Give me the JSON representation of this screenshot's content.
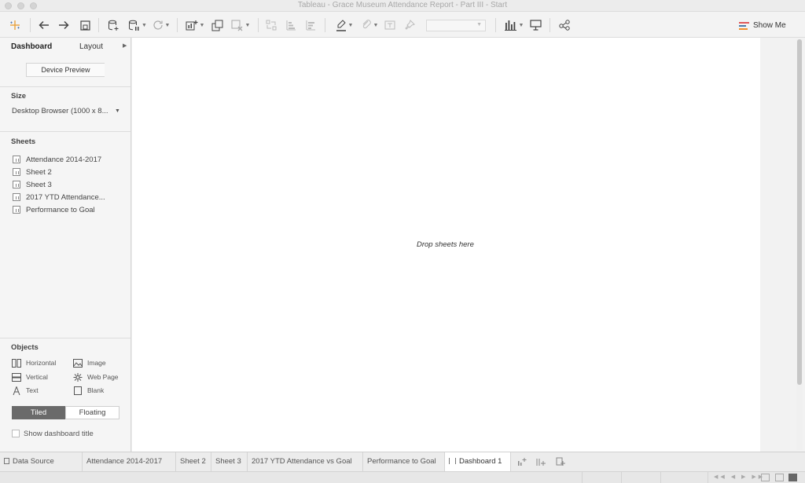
{
  "window": {
    "title": "Tableau - Grace Museum Attendance Report - Part III - Start"
  },
  "toolbar": {
    "show_me_label": "Show Me"
  },
  "left_pane": {
    "tabs": [
      "Dashboard",
      "Layout"
    ],
    "device_preview_label": "Device Preview",
    "size": {
      "title": "Size",
      "value": "Desktop Browser (1000 x 8..."
    },
    "sheets": {
      "title": "Sheets",
      "items": [
        "Attendance 2014-2017",
        "Sheet 2",
        "Sheet 3",
        "2017 YTD Attendance...",
        "Performance to Goal"
      ]
    },
    "objects": {
      "title": "Objects",
      "items": [
        "Horizontal",
        "Image",
        "Vertical",
        "Web Page",
        "Text",
        "Blank"
      ]
    },
    "layout_mode": {
      "tiled": "Tiled",
      "floating": "Floating",
      "selected": "Tiled"
    },
    "show_dashboard_title": "Show dashboard title"
  },
  "canvas": {
    "drop_hint": "Drop sheets here"
  },
  "bottom_tabs": {
    "data_source": "Data Source",
    "tabs": [
      "Attendance 2014-2017",
      "Sheet 2",
      "Sheet 3",
      "2017 YTD Attendance vs Goal",
      "Performance to Goal",
      "Dashboard 1"
    ],
    "active": "Dashboard 1"
  },
  "colors": {
    "tiled_active": "#6a6a6a",
    "canvas": "#ffffff",
    "show_me_bars": [
      "#e15759",
      "#4e79a7",
      "#f28e2b"
    ]
  }
}
